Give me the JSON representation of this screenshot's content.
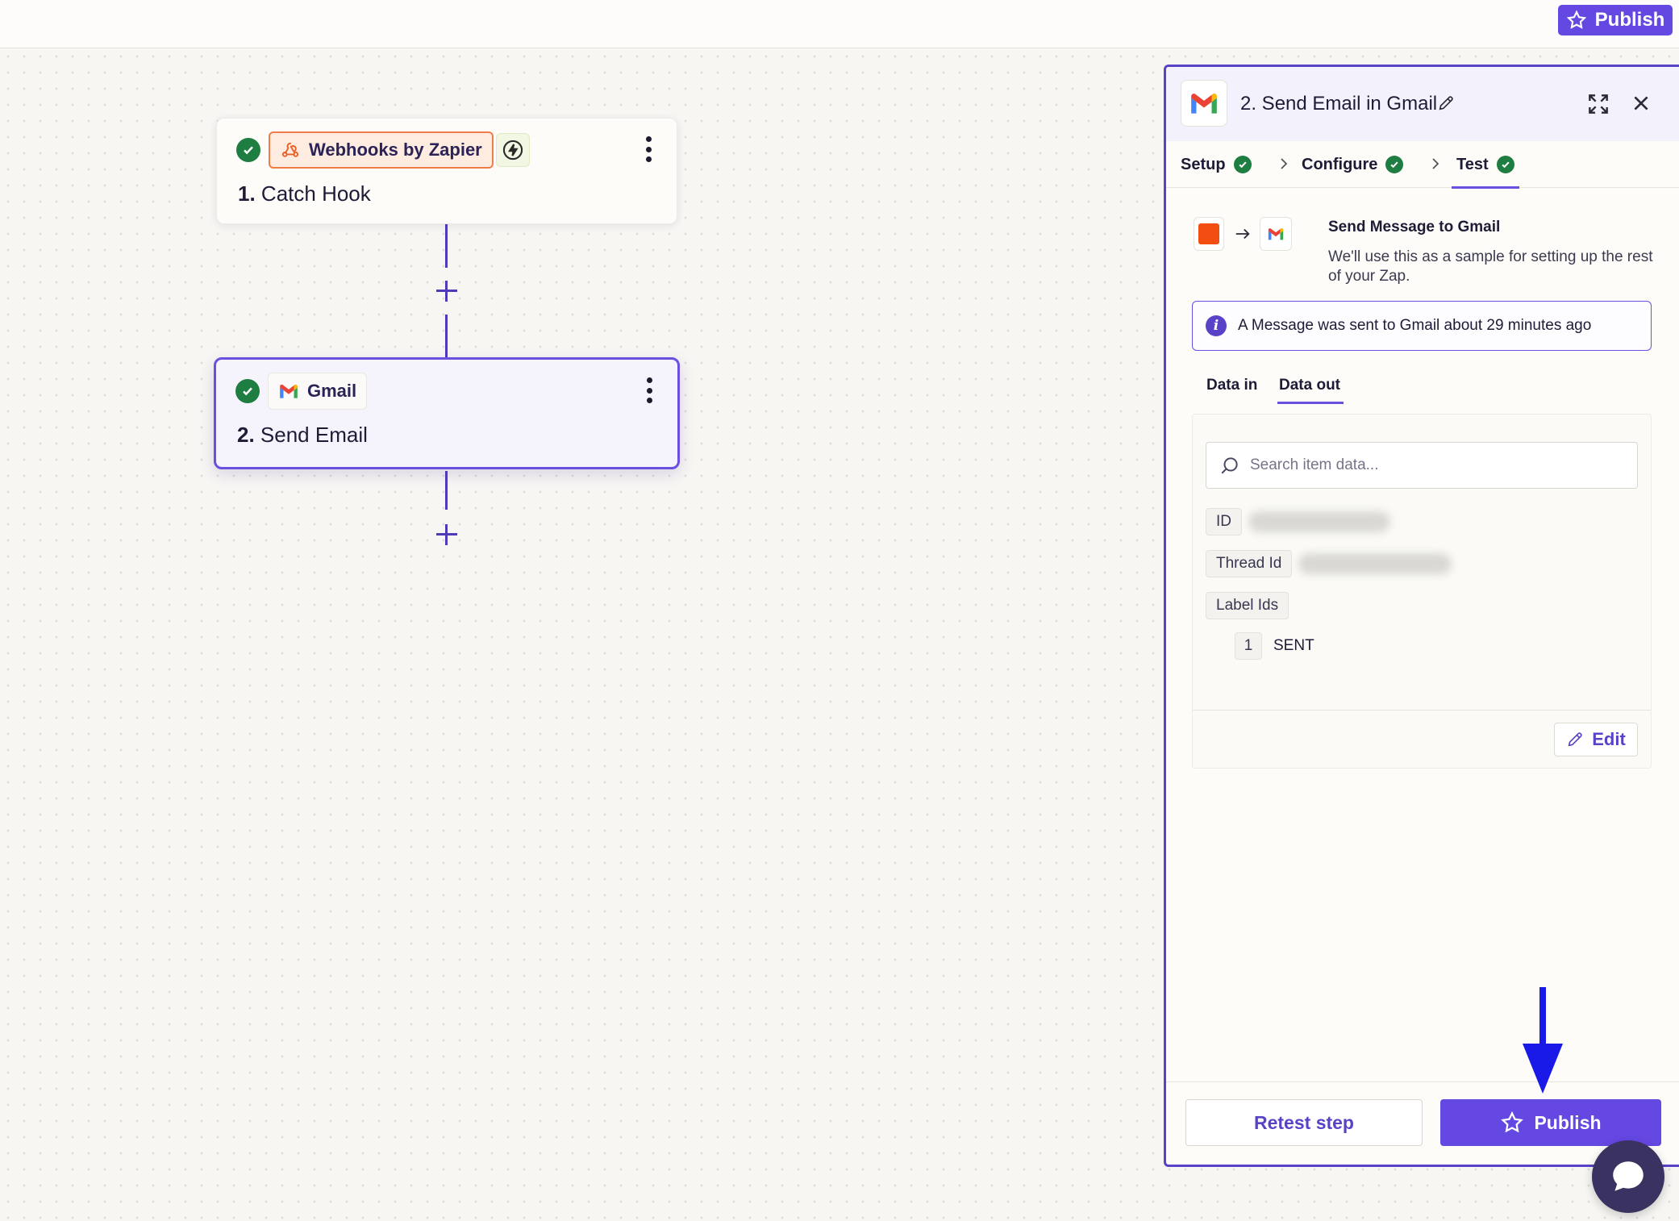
{
  "topbar": {
    "publish_label": "Publish"
  },
  "canvas": {
    "steps": [
      {
        "app": "Webhooks by Zapier",
        "number": "1.",
        "title": "Catch Hook",
        "icon": "webhook-icon",
        "trigger_icon": "bolt-icon"
      },
      {
        "app": "Gmail",
        "number": "2.",
        "title": "Send Email",
        "icon": "gmail-icon"
      }
    ]
  },
  "panel": {
    "title": "2. Send Email in Gmail",
    "tabs": [
      {
        "label": "Setup",
        "done": true
      },
      {
        "label": "Configure",
        "done": true
      },
      {
        "label": "Test",
        "done": true,
        "active": true
      }
    ],
    "sample": {
      "title": "Send Message to Gmail",
      "description": "We'll use this as a sample for setting up the rest of your Zap."
    },
    "info_message": "A Message was sent to Gmail about 29 minutes ago",
    "data_tabs": [
      {
        "label": "Data in"
      },
      {
        "label": "Data out",
        "active": true
      }
    ],
    "search_placeholder": "Search item data...",
    "fields": [
      {
        "key": "ID"
      },
      {
        "key": "Thread Id"
      },
      {
        "key": "Label Ids",
        "items": [
          {
            "index": "1",
            "value": "SENT"
          }
        ]
      }
    ],
    "edit_label": "Edit",
    "retest_label": "Retest step",
    "publish_label": "Publish"
  },
  "colors": {
    "accent": "#6547e2",
    "success": "#1e7d40",
    "webhook_orange": "#f07c4a"
  }
}
